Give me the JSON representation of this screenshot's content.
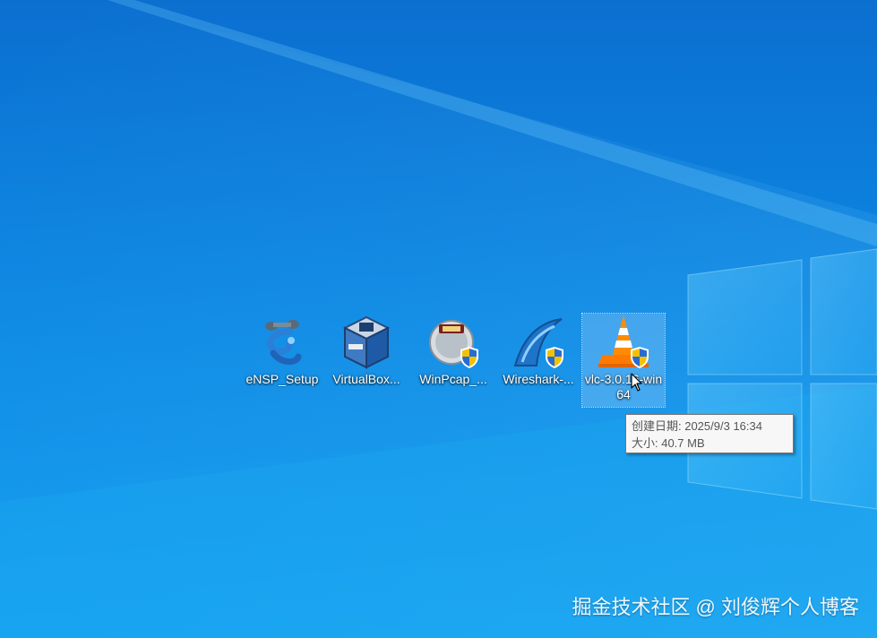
{
  "desktop": {
    "icons": [
      {
        "label": "eNSP_Setup",
        "icon": "ensp-icon"
      },
      {
        "label": "VirtualBox...",
        "icon": "virtualbox-icon"
      },
      {
        "label": "WinPcap_...",
        "icon": "winpcap-icon"
      },
      {
        "label": "Wireshark-...",
        "icon": "wireshark-icon"
      },
      {
        "label": "vlc-3.0.16-win64",
        "icon": "vlc-icon",
        "selected": true
      }
    ]
  },
  "tooltip": {
    "created_label": "创建日期: 2025/9/3 16:34",
    "size_label": "大小: 40.7 MB"
  },
  "watermark": {
    "text": "掘金技术社区 @ 刘俊辉个人博客"
  },
  "colors": {
    "wallpaper_blue": "#0c86e2",
    "icon_selection": "#add8ff"
  }
}
